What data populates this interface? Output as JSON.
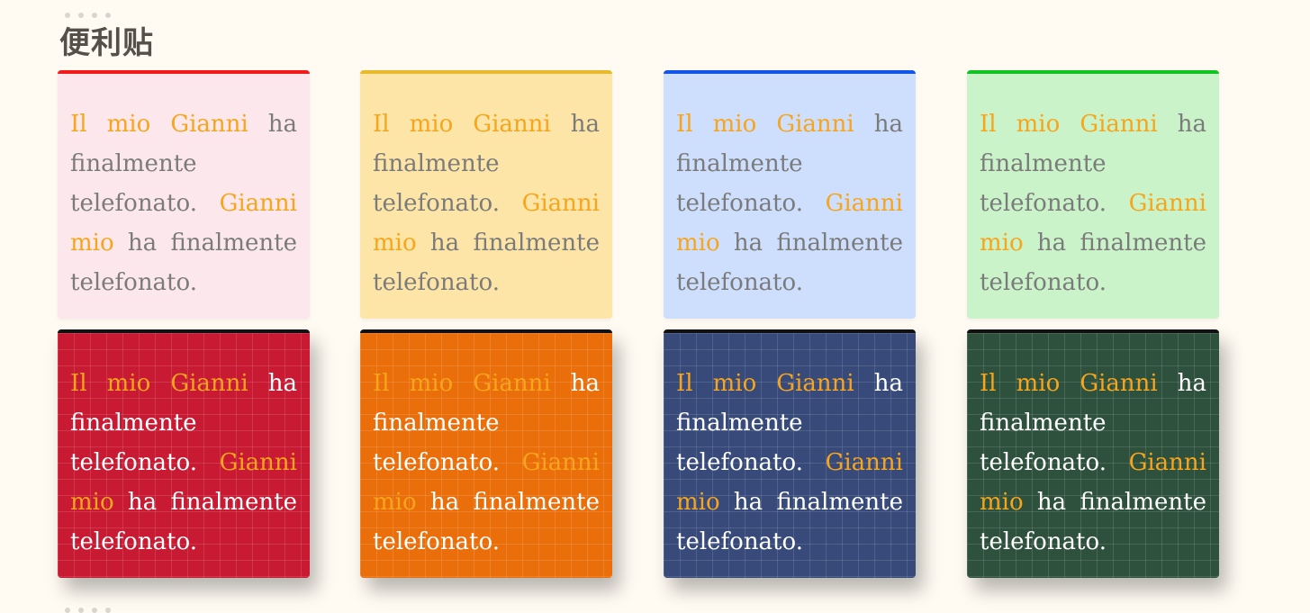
{
  "page": {
    "title": "便利贴"
  },
  "note_text": {
    "w1": "Il",
    "w2": "mio",
    "w3": "Gianni",
    "w4": "ha",
    "w5": "finalmente",
    "w6": "telefonato.",
    "w7": "Gianni",
    "w8": "mio",
    "w9": "ha",
    "w10": "finalmente",
    "w11": "telefonato."
  },
  "colors": {
    "background": "#fffbf3",
    "highlight": "#f7a51c",
    "light_text": "#7b7b7b",
    "dark_text": "#ffffff"
  },
  "notes": [
    {
      "style": "light",
      "bg": "#fce8ec",
      "accent": "#f31a1a"
    },
    {
      "style": "light",
      "bg": "#fde5a7",
      "accent": "#e8b92a"
    },
    {
      "style": "light",
      "bg": "#cedefd",
      "accent": "#1155e8"
    },
    {
      "style": "light",
      "bg": "#caf3ca",
      "accent": "#11c322"
    },
    {
      "style": "dark",
      "bg": "#c81a32",
      "accent": "#111111"
    },
    {
      "style": "dark",
      "bg": "#ea6e0a",
      "accent": "#111111"
    },
    {
      "style": "dark",
      "bg": "#374a7a",
      "accent": "#111111"
    },
    {
      "style": "dark",
      "bg": "#2d513c",
      "accent": "#111111"
    }
  ]
}
